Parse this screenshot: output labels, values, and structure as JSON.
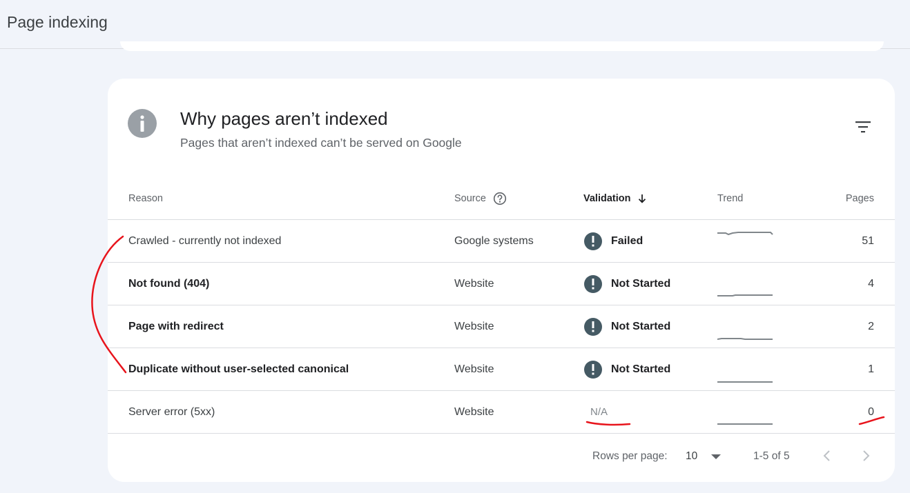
{
  "page": {
    "title": "Page indexing"
  },
  "card": {
    "title": "Why pages aren’t indexed",
    "subtitle": "Pages that aren’t indexed can’t be served on Google",
    "filter_icon": "filter-icon",
    "info_icon": "info-icon"
  },
  "table": {
    "headers": {
      "reason": "Reason",
      "source": "Source",
      "validation": "Validation",
      "trend": "Trend",
      "pages": "Pages"
    },
    "sort": {
      "column": "Validation",
      "direction": "descending"
    },
    "rows": [
      {
        "reason": "Crawled - currently not indexed",
        "source": "Google systems",
        "validation": "Failed",
        "pages": "51",
        "bold": false
      },
      {
        "reason": "Not found (404)",
        "source": "Website",
        "validation": "Not Started",
        "pages": "4",
        "bold": true
      },
      {
        "reason": "Page with redirect",
        "source": "Website",
        "validation": "Not Started",
        "pages": "2",
        "bold": true
      },
      {
        "reason": "Duplicate without user-selected canonical",
        "source": "Website",
        "validation": "Not Started",
        "pages": "1",
        "bold": true
      },
      {
        "reason": "Server error (5xx)",
        "source": "Website",
        "validation": "N/A",
        "pages": "0",
        "bold": false
      }
    ]
  },
  "pagination": {
    "rows_per_page_label": "Rows per page:",
    "rows_per_page_value": "10",
    "range": "1-5 of 5"
  },
  "colors": {
    "background": "#f1f4fa",
    "card": "#ffffff",
    "validation_icon": "#455a64",
    "annotation": "#e8141c"
  }
}
